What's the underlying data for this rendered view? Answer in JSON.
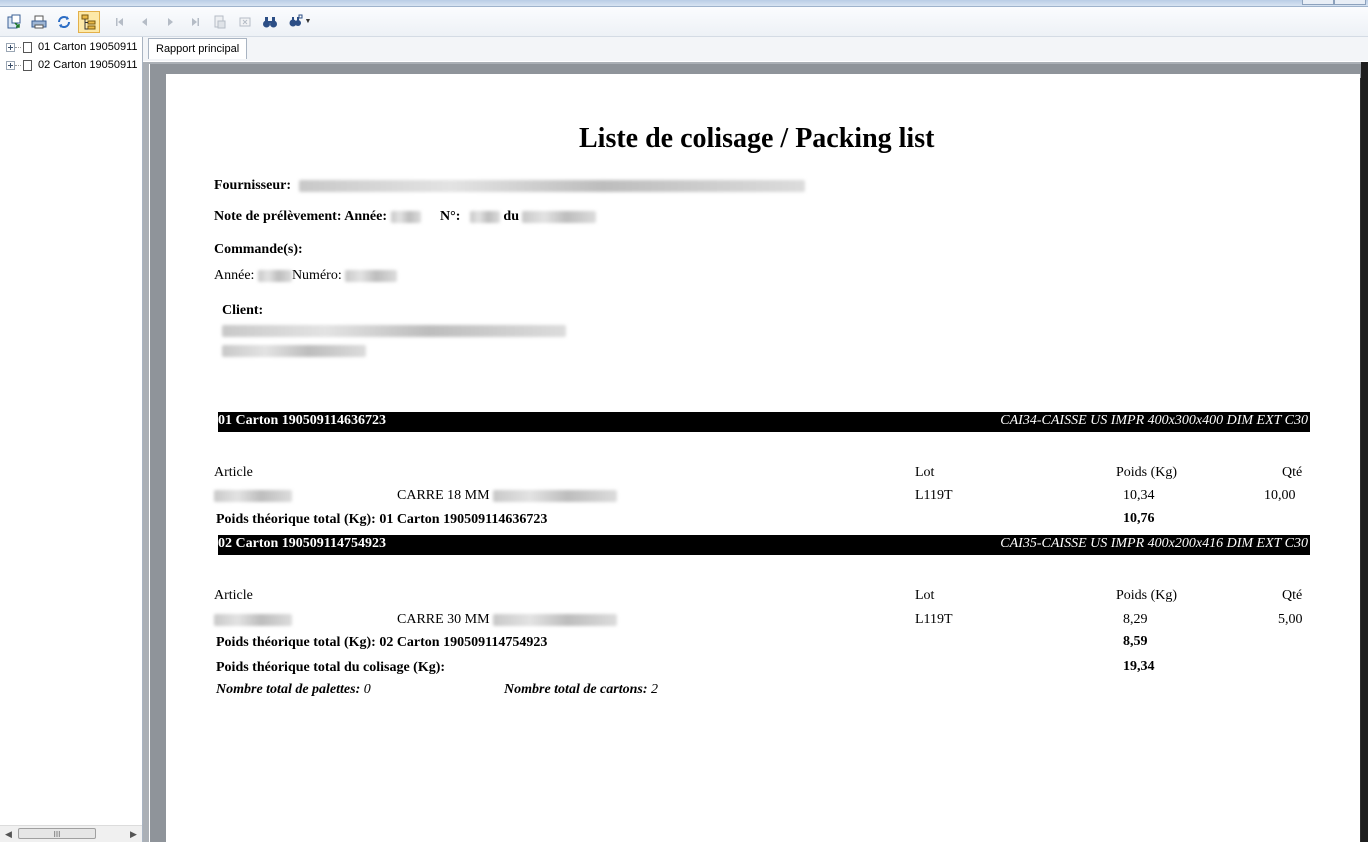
{
  "window": {
    "tab_label": "Rapport principal"
  },
  "tree": {
    "items": [
      {
        "label": "01 Carton 19050911"
      },
      {
        "label": "02 Carton 19050911"
      }
    ],
    "scroll_grip": "III"
  },
  "toolbar": {
    "icons": [
      "export-icon",
      "print-icon",
      "refresh-icon",
      "tree-toggle-icon",
      "first-page-icon",
      "prev-page-icon",
      "next-page-icon",
      "last-page-icon",
      "goto-page-icon",
      "close-icon",
      "find-icon",
      "zoom-icon"
    ]
  },
  "report": {
    "title": "Liste de colisage / Packing list",
    "supplier_label": "Fournisseur:",
    "note_label": "Note de prélèvement:",
    "annee_label": "Année:",
    "no_label": "N°:",
    "du_label": "du",
    "orders_label": "Commande(s):",
    "order_annee_label": "Année:",
    "order_numero_label": "Numéro:",
    "client_label": "Client:",
    "col_article": "Article",
    "col_lot": "Lot",
    "col_poids": "Poids (Kg)",
    "col_qte": "Qté",
    "cartons": [
      {
        "header": "01 Carton 190509114636723",
        "box_type": "CAI34-CAISSE US IMPR 400x300x400 DIM EXT C30",
        "line_desc": "CARRE 18 MM",
        "lot": "L119T",
        "poids": "10,34",
        "qte": "10,00",
        "total_label": "Poids théorique total (Kg): 01 Carton 190509114636723",
        "total_value": "10,76"
      },
      {
        "header": "02 Carton 190509114754923",
        "box_type": "CAI35-CAISSE US IMPR 400x200x416 DIM EXT C30",
        "line_desc": "CARRE 30 MM",
        "lot": "L119T",
        "poids": "8,29",
        "qte": "5,00",
        "total_label": "Poids théorique total (Kg): 02 Carton 190509114754923",
        "total_value": "8,59"
      }
    ],
    "grand_total_label": "Poids théorique total du colisage (Kg):",
    "grand_total_value": "19,34",
    "pallets_label": "Nombre total de palettes:",
    "pallets_value": "0",
    "cartons_label": "Nombre total de cartons:",
    "cartons_value": "2"
  }
}
